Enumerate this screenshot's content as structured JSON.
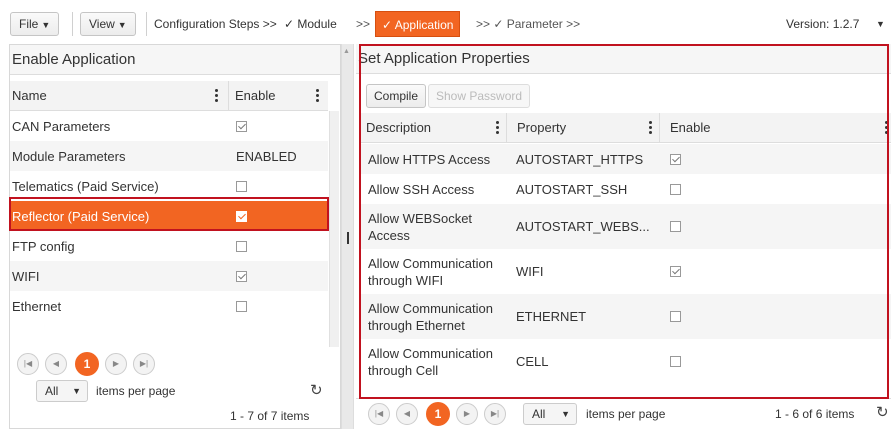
{
  "toolbar": {
    "file_label": "File",
    "view_label": "View",
    "steps_prefix": "Configuration Steps >>",
    "step_module": "✓ Module",
    "sep1": ">>",
    "step_application": "✓ Application",
    "sep2": ">> ✓ Parameter >>",
    "version": "Version: 1.2.7"
  },
  "left": {
    "title": "Enable Application",
    "col_name": "Name",
    "col_enable": "Enable",
    "rows": [
      {
        "name": "CAN Parameters",
        "enable": "checked"
      },
      {
        "name": "Module Parameters",
        "enable": "ENABLED"
      },
      {
        "name": "Telematics (Paid Service)",
        "enable": "unchecked"
      },
      {
        "name": "Reflector (Paid Service)",
        "enable": "checked"
      },
      {
        "name": "FTP config",
        "enable": "unchecked"
      },
      {
        "name": "WIFI",
        "enable": "checked"
      },
      {
        "name": "Ethernet",
        "enable": "unchecked"
      }
    ],
    "pager": {
      "current_page": "1",
      "items_per_page_value": "All",
      "items_per_page_label": "items per page",
      "summary": "1 - 7 of 7 items"
    }
  },
  "right": {
    "title": "Set Application Properties",
    "compile_label": "Compile",
    "show_password_label": "Show Password",
    "col_description": "Description",
    "col_property": "Property",
    "col_enable": "Enable",
    "rows": [
      {
        "description": "Allow HTTPS Access",
        "property": "AUTOSTART_HTTPS",
        "enable": "checked"
      },
      {
        "description": "Allow SSH Access",
        "property": "AUTOSTART_SSH",
        "enable": "unchecked"
      },
      {
        "description": "Allow WEBSocket Access",
        "property": "AUTOSTART_WEBS...",
        "enable": "unchecked"
      },
      {
        "description": "Allow Communication through WIFI",
        "property": "WIFI",
        "enable": "checked"
      },
      {
        "description": "Allow Communication through Ethernet",
        "property": "ETHERNET",
        "enable": "unchecked"
      },
      {
        "description": "Allow Communication through Cell",
        "property": "CELL",
        "enable": "unchecked"
      }
    ],
    "pager": {
      "current_page": "1",
      "items_per_page_value": "All",
      "items_per_page_label": "items per page",
      "summary": "1 - 6 of 6 items"
    }
  },
  "colors": {
    "accent": "#f26522",
    "highlight_border": "#c1121f"
  }
}
